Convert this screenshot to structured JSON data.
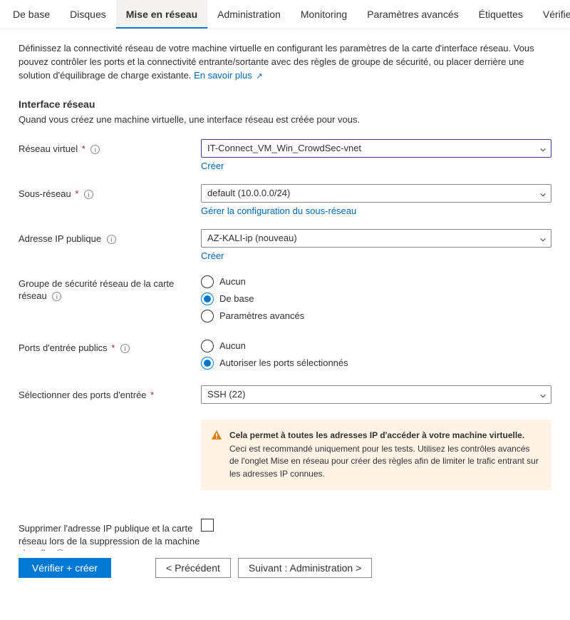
{
  "tabs": [
    {
      "label": "De base"
    },
    {
      "label": "Disques"
    },
    {
      "label": "Mise en réseau",
      "active": true
    },
    {
      "label": "Administration"
    },
    {
      "label": "Monitoring"
    },
    {
      "label": "Paramètres avancés"
    },
    {
      "label": "Étiquettes"
    },
    {
      "label": "Vérifier +"
    }
  ],
  "intro": {
    "text": "Définissez la connectivité réseau de votre machine virtuelle en configurant les paramètres de la carte d'interface réseau. Vous pouvez contrôler les ports et la connectivité entrante/sortante avec des règles de groupe de sécurité, ou placer derrière une solution d'équilibrage de charge existante.",
    "learn_more": "En savoir plus"
  },
  "section": {
    "title": "Interface réseau",
    "desc": "Quand vous créez une machine virtuelle, une interface réseau est créée pour vous."
  },
  "fields": {
    "vnet": {
      "label": "Réseau virtuel",
      "value": "IT-Connect_VM_Win_CrowdSec-vnet",
      "create": "Créer"
    },
    "subnet": {
      "label": "Sous-réseau",
      "value": "default (10.0.0.0/24)",
      "manage": "Gérer la configuration du sous-réseau"
    },
    "publicip": {
      "label": "Adresse IP publique",
      "value": "AZ-KALI-ip (nouveau)",
      "create": "Créer"
    },
    "nsg": {
      "label": "Groupe de sécurité réseau de la carte réseau",
      "options": [
        "Aucun",
        "De base",
        "Paramètres avancés"
      ],
      "selected": 1
    },
    "inboundPorts": {
      "label": "Ports d'entrée publics",
      "options": [
        "Aucun",
        "Autoriser les ports sélectionnés"
      ],
      "selected": 1
    },
    "selectPorts": {
      "label": "Sélectionner des ports d'entrée",
      "value": "SSH (22)"
    },
    "deleteOnVm": {
      "label": "Supprimer l'adresse IP publique et la carte réseau lors de la suppression de la machine virtuelle"
    }
  },
  "warning": {
    "title": "Cela permet à toutes les adresses IP d'accéder à votre machine virtuelle.",
    "body": " Ceci est recommandé uniquement pour les tests.  Utilisez les contrôles avancés de l'onglet Mise en réseau pour créer des règles afin de limiter le trafic entrant sur les adresses IP connues."
  },
  "footer": {
    "review": "Vérifier + créer",
    "previous": "< Précédent",
    "next": "Suivant : Administration >"
  }
}
